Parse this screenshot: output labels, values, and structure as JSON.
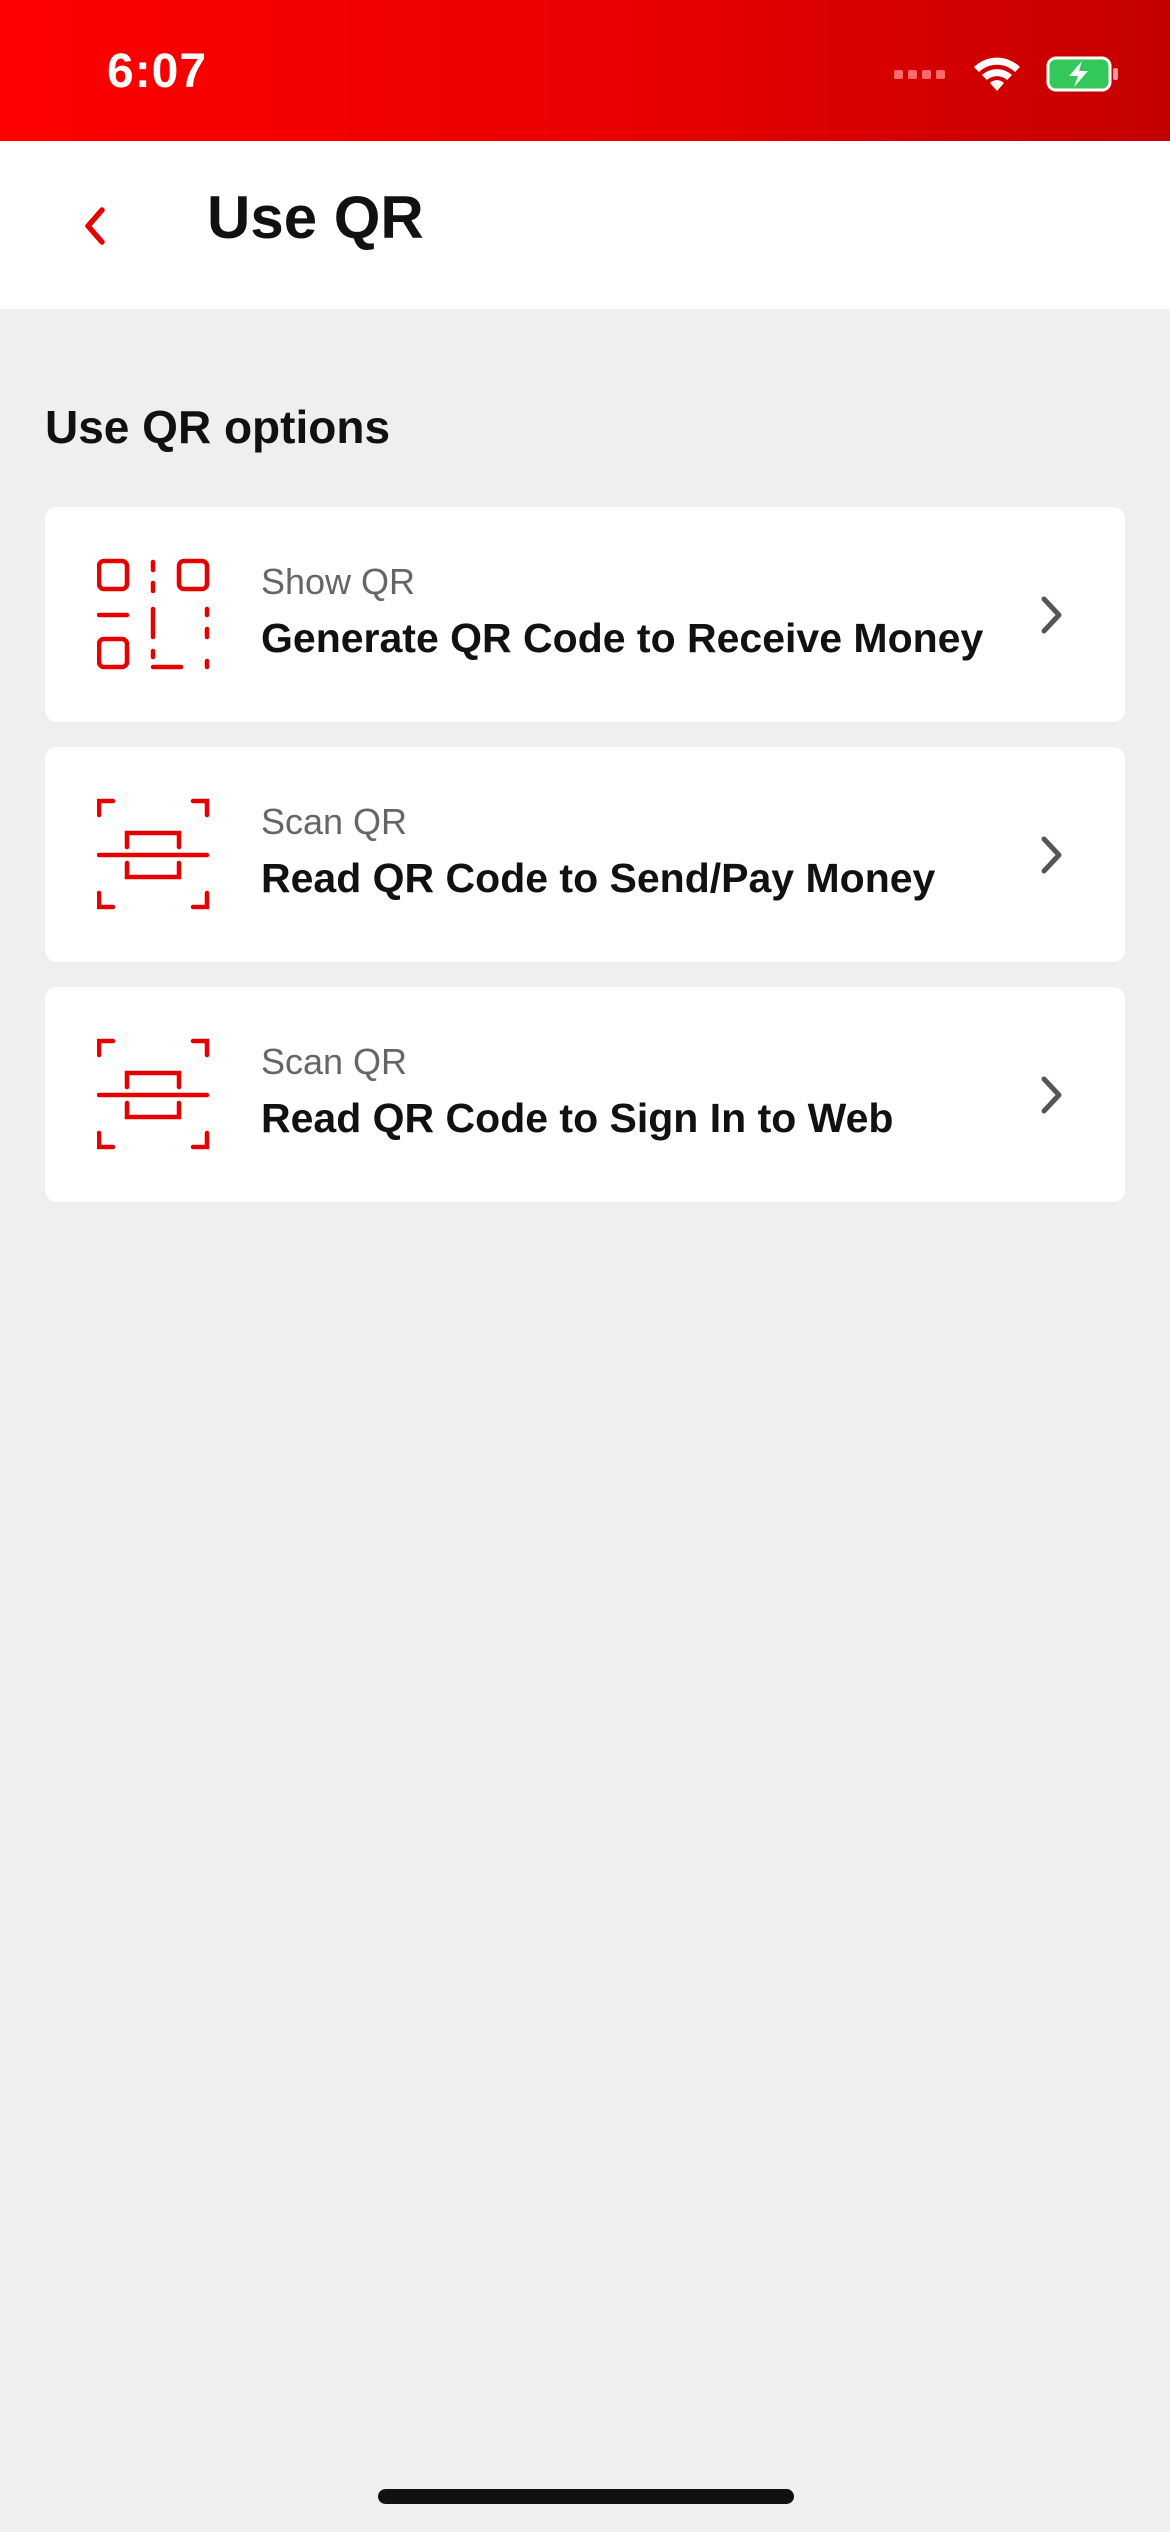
{
  "status_bar": {
    "time": "6:07",
    "signal_icon": "cellular-signal-icon",
    "wifi_icon": "wifi-icon",
    "battery_icon": "battery-charging-icon"
  },
  "header": {
    "back_icon": "chevron-left-icon",
    "title": "Use QR"
  },
  "section": {
    "title": "Use QR options"
  },
  "options": [
    {
      "icon": "qr-code-icon",
      "subtitle": "Show QR",
      "title": "Generate QR Code to Receive Money",
      "chevron_icon": "chevron-right-icon"
    },
    {
      "icon": "qr-scan-icon",
      "subtitle": "Scan QR",
      "title": "Read QR Code to Send/Pay Money",
      "chevron_icon": "chevron-right-icon"
    },
    {
      "icon": "qr-scan-icon",
      "subtitle": "Scan QR",
      "title": "Read QR Code to Sign In to Web",
      "chevron_icon": "chevron-right-icon"
    }
  ],
  "colors": {
    "brand_red": "#e60000",
    "background": "#eeeff1",
    "card": "#ffffff",
    "battery_green": "#34c759"
  }
}
